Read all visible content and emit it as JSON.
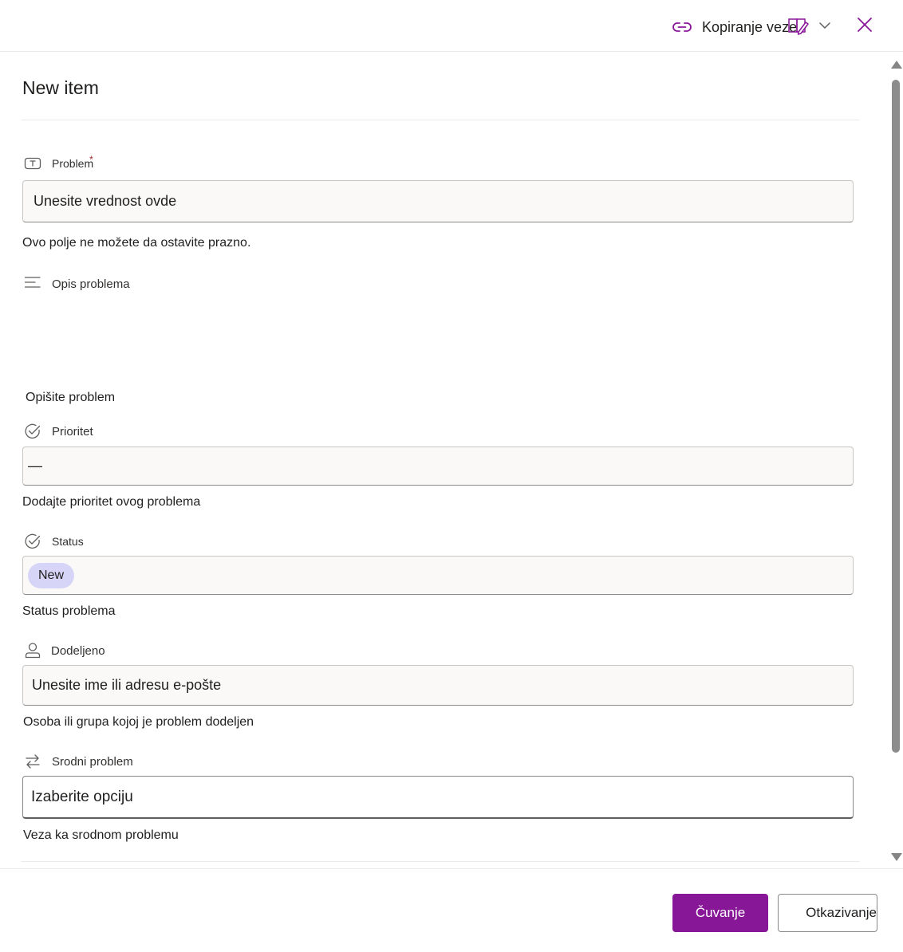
{
  "header": {
    "copy_link_label": "Kopiranje veze",
    "link_icon": "link-icon",
    "edit_icon": "edit-form-icon",
    "chevron_icon": "chevron-down-icon",
    "close_icon": "close-icon",
    "accent_color": "#881798"
  },
  "form": {
    "title": "New item",
    "fields": {
      "problem": {
        "label": "Problem",
        "required_mark": "*",
        "value": "Unesite vrednost ovde",
        "helper": "Ovo polje ne možete da ostavite prazno.",
        "icon": "text-field-icon"
      },
      "description": {
        "label": "Opis problema",
        "helper": "Opišite problem",
        "icon": "multiline-text-icon"
      },
      "priority": {
        "label": "Prioritet",
        "value": "—",
        "helper": "Dodajte prioritet ovog problema",
        "icon": "choice-check-icon"
      },
      "status": {
        "label": "Status",
        "value": "New",
        "helper": "Status problema",
        "icon": "choice-check-icon",
        "pill_color": "#d6d5f7"
      },
      "assigned": {
        "label": "Dodeljeno",
        "value": "Unesite ime ili adresu e-pošte",
        "helper": "Osoba ili grupa kojoj je problem dodeljen",
        "icon": "person-icon"
      },
      "related": {
        "label": "Srodni problem",
        "value": "Izaberite opciju",
        "helper": "Veza ka srodnom problemu",
        "icon": "lookup-arrows-icon"
      }
    }
  },
  "footer": {
    "save_label": "Čuvanje",
    "cancel_label": "Otkazivanje"
  }
}
